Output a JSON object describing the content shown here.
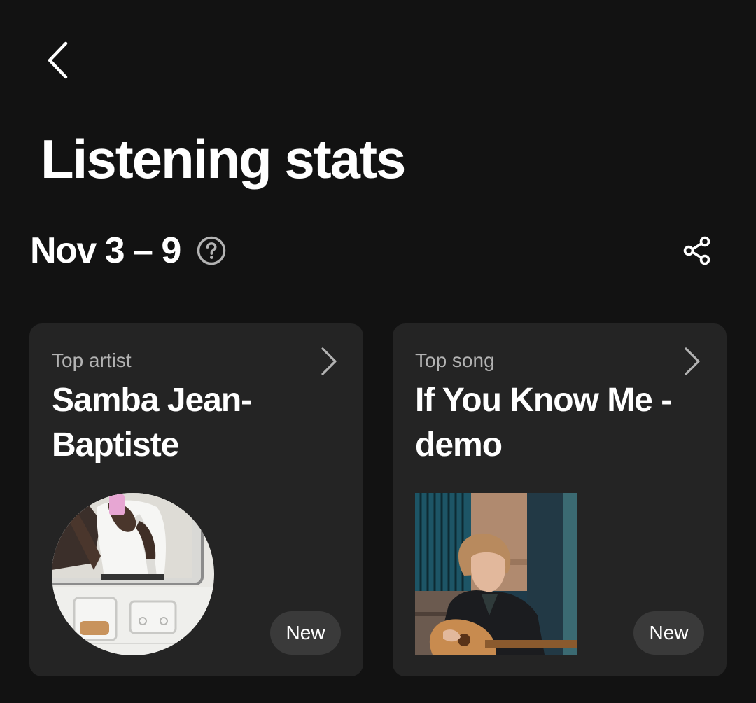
{
  "header": {
    "title": "Listening stats"
  },
  "period": {
    "label": "Nov 3 – 9"
  },
  "icons": {
    "back": "chevron-left",
    "help": "question-circle",
    "share": "share-nodes",
    "card_chevron": "chevron-right"
  },
  "cards": [
    {
      "label": "Top artist",
      "title": "Samba Jean-Baptiste",
      "badge": "New",
      "image": "artist-photo"
    },
    {
      "label": "Top song",
      "title": "If You Know Me - demo",
      "badge": "New",
      "image": "album-cover"
    }
  ],
  "colors": {
    "background": "#121212",
    "card": "#242424",
    "badge": "#3a3a3a",
    "secondary_text": "#b3b3b3"
  }
}
